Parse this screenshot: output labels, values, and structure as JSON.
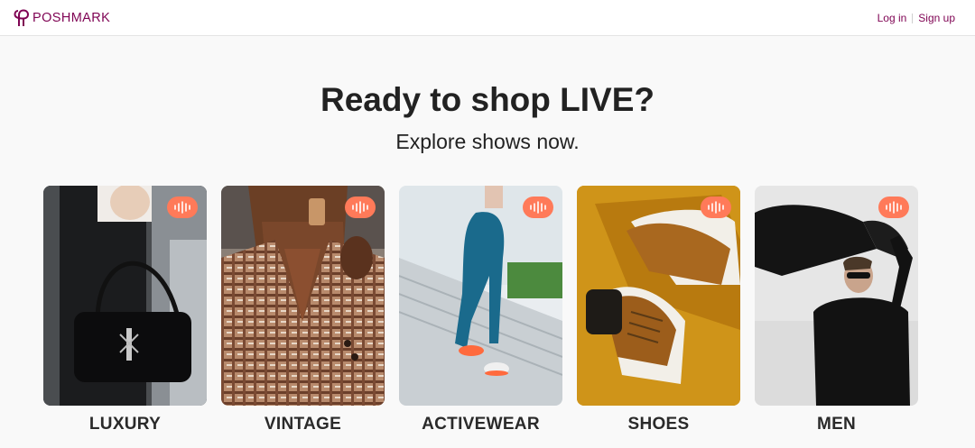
{
  "header": {
    "brand": "POSHMARK",
    "login_label": "Log in",
    "signup_label": "Sign up"
  },
  "hero": {
    "title": "Ready to shop LIVE?",
    "subtitle": "Explore shows now."
  },
  "categories": [
    {
      "label": "LUXURY",
      "icon": "live-audio-icon"
    },
    {
      "label": "VINTAGE",
      "icon": "live-audio-icon"
    },
    {
      "label": "ACTIVEWEAR",
      "icon": "live-audio-icon"
    },
    {
      "label": "SHOES",
      "icon": "live-audio-icon"
    },
    {
      "label": "MEN",
      "icon": "live-audio-icon"
    }
  ],
  "colors": {
    "brand": "#7f0353",
    "live_badge": "#ff7a59",
    "page_background": "#f9f9f9"
  }
}
